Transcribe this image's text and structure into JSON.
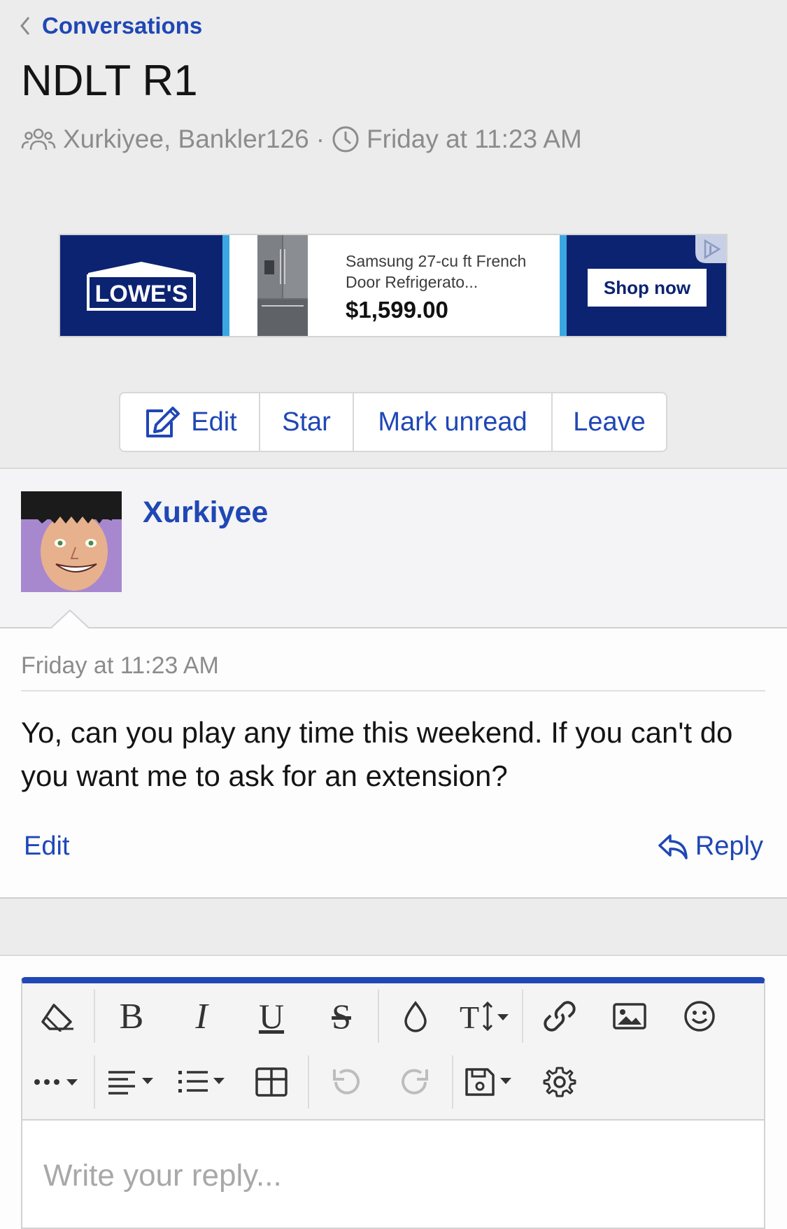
{
  "nav": {
    "back_label": "Conversations"
  },
  "conversation": {
    "title": "NDLT R1",
    "participants": "Xurkiyee, Bankler126",
    "separator": "·",
    "started": "Friday at 11:23 AM"
  },
  "ad": {
    "brand": "LOWE'S",
    "product": "Samsung 27-cu ft French Door Refrigerato...",
    "price": "$1,599.00",
    "cta": "Shop now",
    "colors": {
      "brand_blue": "#0c2372",
      "accent_blue": "#3ba7e0"
    }
  },
  "actions": {
    "edit": "Edit",
    "star": "Star",
    "mark_unread": "Mark unread",
    "leave": "Leave"
  },
  "message": {
    "author": "Xurkiyee",
    "date": "Friday at 11:23 AM",
    "text": "Yo, can you play any time this weekend. If you can't do you want me to ask for an extension?",
    "edit_label": "Edit",
    "reply_label": "Reply"
  },
  "editor": {
    "placeholder": "Write your reply...",
    "toolbar_row1": [
      "eraser-icon",
      "bold-icon",
      "italic-icon",
      "underline-icon",
      "strikethrough-icon",
      "text-color-icon",
      "font-size-icon",
      "link-icon",
      "image-icon",
      "smiley-icon"
    ],
    "toolbar_row2": [
      "more-icon",
      "align-icon",
      "list-icon",
      "table-icon",
      "undo-icon",
      "redo-icon",
      "save-draft-icon",
      "settings-icon"
    ]
  },
  "theme": {
    "link_blue": "#1f47b5",
    "muted_gray": "#8c8c8c",
    "page_bg": "#ececec"
  }
}
